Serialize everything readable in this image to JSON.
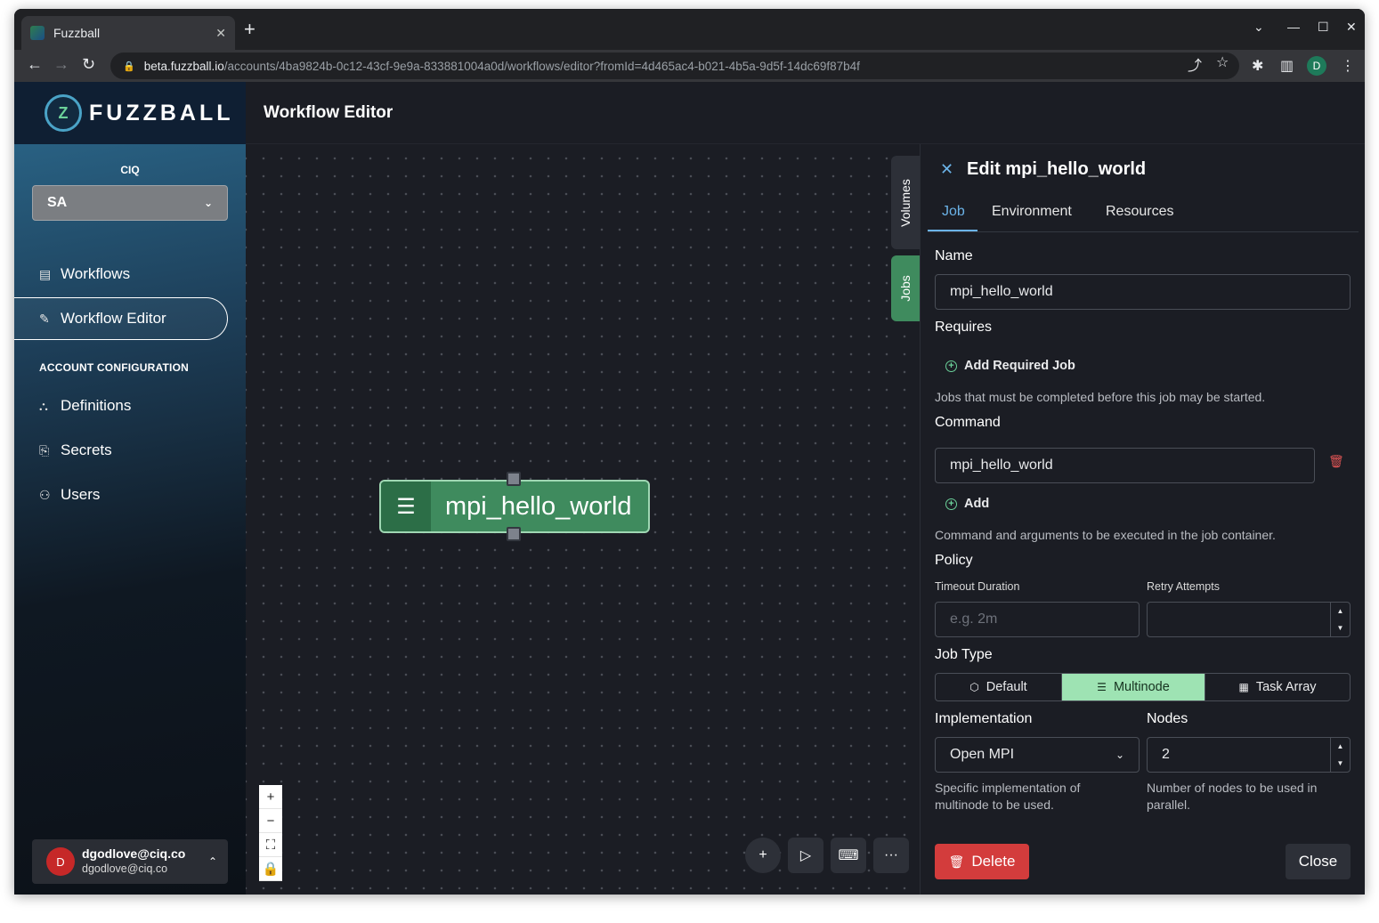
{
  "browser": {
    "tab_title": "Fuzzball",
    "tab_close": "✕",
    "new_tab": "+",
    "url_host": "beta.fuzzball.io",
    "url_path": "/accounts/4ba9824b-0c12-43cf-9e9a-833881004a0d/workflows/editor?fromId=4d465ac4-b021-4b5a-9d5f-14dc69f87b4f",
    "profile_initial": "D"
  },
  "sidebar": {
    "brand_name": "FUZZBALL",
    "org_label": "CIQ",
    "org_value": "SA",
    "nav": [
      {
        "label": "Workflows",
        "icon": "list-icon"
      },
      {
        "label": "Workflow Editor",
        "icon": "edit-icon",
        "active": true
      }
    ],
    "section_title": "ACCOUNT CONFIGURATION",
    "config_nav": [
      {
        "label": "Definitions",
        "icon": "sitemap-icon"
      },
      {
        "label": "Secrets",
        "icon": "secret-icon"
      },
      {
        "label": "Users",
        "icon": "users-icon"
      }
    ],
    "user": {
      "initial": "D",
      "name": "dgodlove@ciq.co",
      "email": "dgodlove@ciq.co"
    }
  },
  "header": {
    "title": "Workflow Editor"
  },
  "canvas": {
    "node_label": "mpi_hello_world",
    "side_tabs": [
      "Volumes",
      "Jobs"
    ],
    "zoom": [
      "+",
      "−",
      "⛶",
      "🔒"
    ]
  },
  "panel": {
    "title": "Edit mpi_hello_world",
    "tabs": [
      "Job",
      "Environment",
      "Resources"
    ],
    "active_tab": "Job",
    "name_label": "Name",
    "name_value": "mpi_hello_world",
    "requires_label": "Requires",
    "add_required_job": "Add Required Job",
    "requires_help": "Jobs that must be completed before this job may be started.",
    "command_label": "Command",
    "command_value": "mpi_hello_world",
    "add_label": "Add",
    "command_help": "Command and arguments to be executed in the job container.",
    "policy_label": "Policy",
    "timeout_label": "Timeout Duration",
    "timeout_placeholder": "e.g. 2m",
    "retry_label": "Retry Attempts",
    "retry_value": "",
    "job_type_label": "Job Type",
    "job_types": [
      "Default",
      "Multinode",
      "Task Array"
    ],
    "job_type_selected": "Multinode",
    "implementation_label": "Implementation",
    "implementation_value": "Open MPI",
    "implementation_help": "Specific implementation of multinode to be used.",
    "nodes_label": "Nodes",
    "nodes_value": "2",
    "nodes_help": "Number of nodes to be used in parallel.",
    "delete_label": "Delete",
    "close_label": "Close"
  },
  "colors": {
    "accent": "#6bb3e8",
    "node_green": "#3f8b5e",
    "selected_segment": "#9ee3b3",
    "danger": "#d33c3c"
  }
}
